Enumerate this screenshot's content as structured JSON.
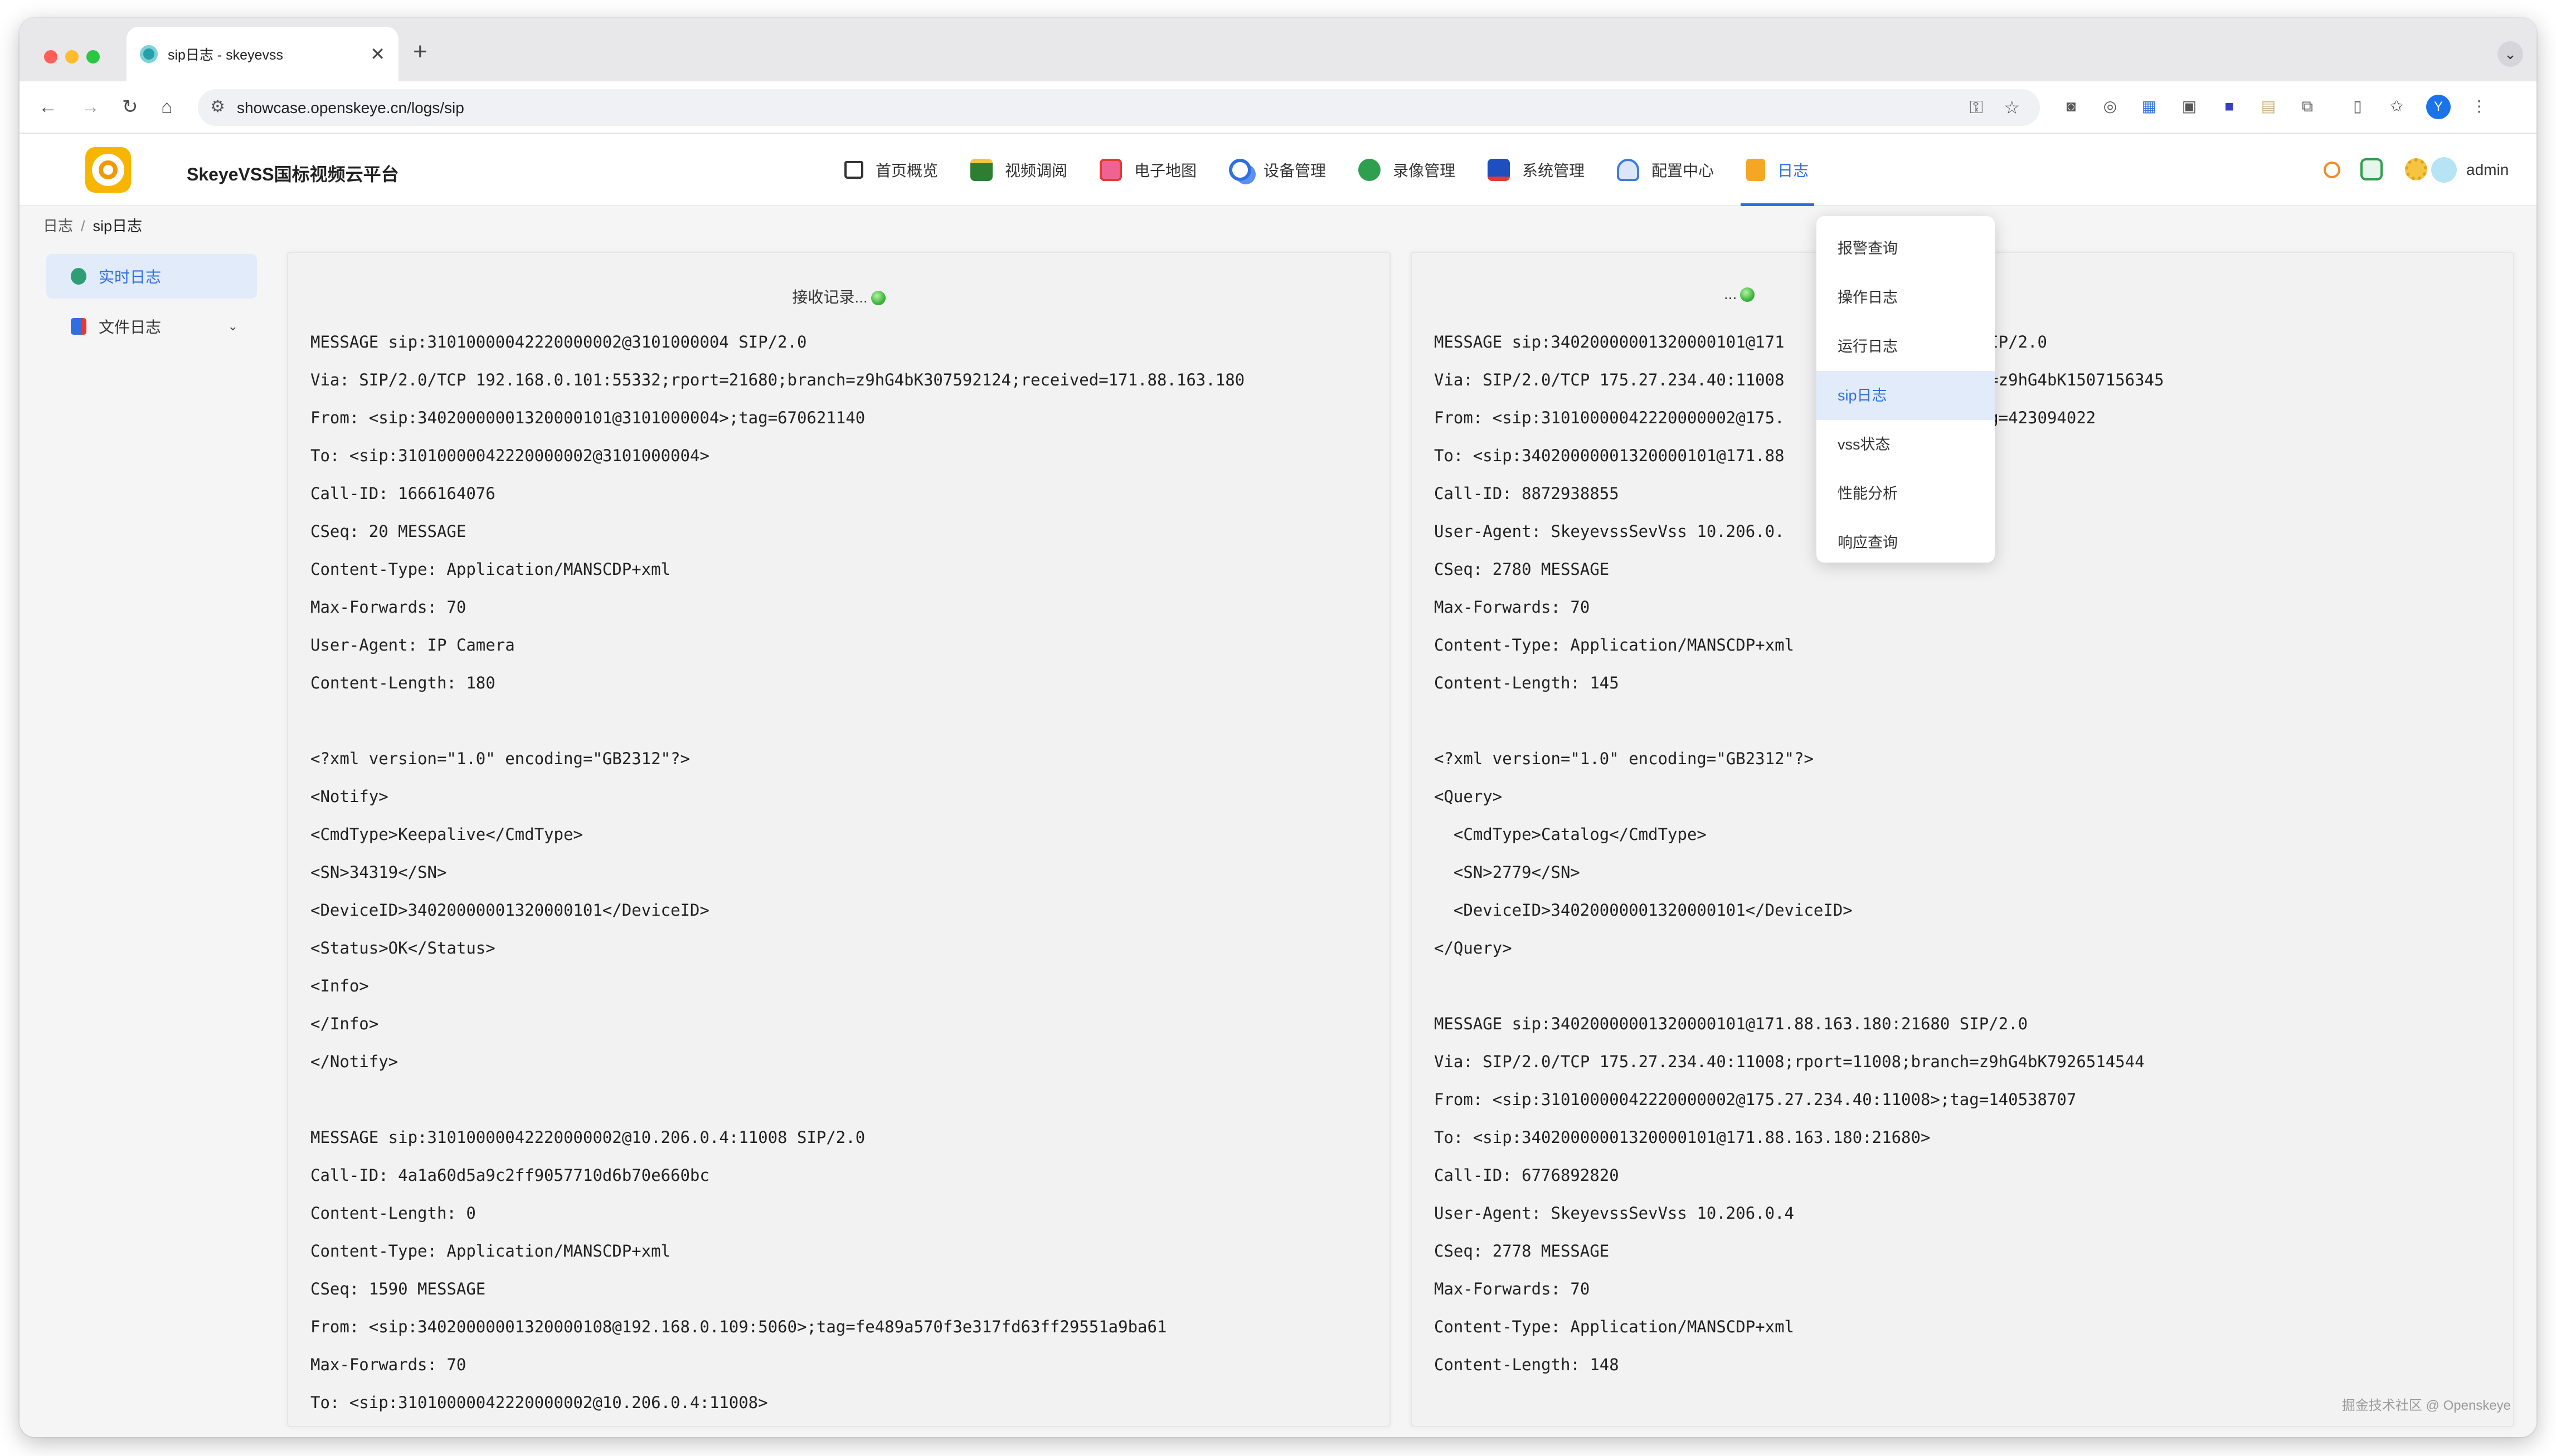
{
  "browser": {
    "tab_title": "sip日志 - skeyevss",
    "new_tab": "+",
    "tab_close": "✕",
    "url": "showcase.openskeye.cn/logs/sip",
    "profile_initial": "Y"
  },
  "app": {
    "title": "SkeyeVSS国标视频云平台",
    "nav": [
      {
        "label": "首页概览",
        "icon": "home-icon",
        "color": "#333333"
      },
      {
        "label": "视频调阅",
        "icon": "video-icon",
        "color": "#2e7d32"
      },
      {
        "label": "电子地图",
        "icon": "map-icon",
        "color": "#e53935"
      },
      {
        "label": "设备管理",
        "icon": "devices-icon",
        "color": "#2f6fe0"
      },
      {
        "label": "录像管理",
        "icon": "record-icon",
        "color": "#2e9e4f"
      },
      {
        "label": "系统管理",
        "icon": "system-icon",
        "color": "#1e4fbf"
      },
      {
        "label": "配置中心",
        "icon": "config-icon",
        "color": "#3f7be0"
      },
      {
        "label": "日志",
        "icon": "log-icon",
        "color": "#f5a623"
      }
    ],
    "user": "admin"
  },
  "breadcrumb": {
    "parent": "日志",
    "separator": "/",
    "current": "sip日志"
  },
  "sidebar": {
    "items": [
      {
        "label": "实时日志",
        "active": true
      },
      {
        "label": "文件日志",
        "expand": "⌄"
      }
    ]
  },
  "dropdown": {
    "items": [
      {
        "label": "报警查询"
      },
      {
        "label": "操作日志"
      },
      {
        "label": "运行日志"
      },
      {
        "label": "sip日志",
        "active": true
      },
      {
        "label": "vss状态"
      },
      {
        "label": "性能分析"
      },
      {
        "label": "响应查询"
      }
    ]
  },
  "panels": {
    "left": {
      "title": "接收记录...",
      "lines": [
        "MESSAGE sip:31010000042220000002@3101000004 SIP/2.0",
        "Via: SIP/2.0/TCP 192.168.0.101:55332;rport=21680;branch=z9hG4bK307592124;received=171.88.163.180",
        "From: <sip:34020000001320000101@3101000004>;tag=670621140",
        "To: <sip:31010000042220000002@3101000004>",
        "Call-ID: 1666164076",
        "CSeq: 20 MESSAGE",
        "Content-Type: Application/MANSCDP+xml",
        "Max-Forwards: 70",
        "User-Agent: IP Camera",
        "Content-Length: 180",
        "",
        "<?xml version=\"1.0\" encoding=\"GB2312\"?>",
        "<Notify>",
        "<CmdType>Keepalive</CmdType>",
        "<SN>34319</SN>",
        "<DeviceID>34020000001320000101</DeviceID>",
        "<Status>OK</Status>",
        "<Info>",
        "</Info>",
        "</Notify>",
        "",
        "MESSAGE sip:31010000042220000002@10.206.0.4:11008 SIP/2.0",
        "Call-ID: 4a1a60d5a9c2ff9057710d6b70e660bc",
        "Content-Length: 0",
        "Content-Type: Application/MANSCDP+xml",
        "CSeq: 1590 MESSAGE",
        "From: <sip:34020000001320000108@192.168.0.109:5060>;tag=fe489a570f3e317fd63ff29551a9ba61",
        "Max-Forwards: 70",
        "To: <sip:31010000042220000002@10.206.0.4:11008>"
      ]
    },
    "right": {
      "title": "...",
      "lines": [
        "MESSAGE sip:34020000001320000101@171                    SIP/2.0",
        "Via: SIP/2.0/TCP 175.27.234.40:11008                   ch=z9hG4bK1507156345",
        "From: <sip:31010000042220000002@175.                   tag=423094022",
        "To: <sip:34020000001320000101@171.88",
        "Call-ID: 8872938855",
        "User-Agent: SkeyevssSevVss 10.206.0.",
        "CSeq: 2780 MESSAGE",
        "Max-Forwards: 70",
        "Content-Type: Application/MANSCDP+xml",
        "Content-Length: 145",
        "",
        "<?xml version=\"1.0\" encoding=\"GB2312\"?>",
        "<Query>",
        "  <CmdType>Catalog</CmdType>",
        "  <SN>2779</SN>",
        "  <DeviceID>34020000001320000101</DeviceID>",
        "</Query>",
        "",
        "MESSAGE sip:34020000001320000101@171.88.163.180:21680 SIP/2.0",
        "Via: SIP/2.0/TCP 175.27.234.40:11008;rport=11008;branch=z9hG4bK7926514544",
        "From: <sip:31010000042220000002@175.27.234.40:11008>;tag=140538707",
        "To: <sip:34020000001320000101@171.88.163.180:21680>",
        "Call-ID: 6776892820",
        "User-Agent: SkeyevssSevVss 10.206.0.4",
        "CSeq: 2778 MESSAGE",
        "Max-Forwards: 70",
        "Content-Type: Application/MANSCDP+xml",
        "Content-Length: 148"
      ]
    }
  },
  "watermark": "掘金技术社区 @ Openskeye"
}
